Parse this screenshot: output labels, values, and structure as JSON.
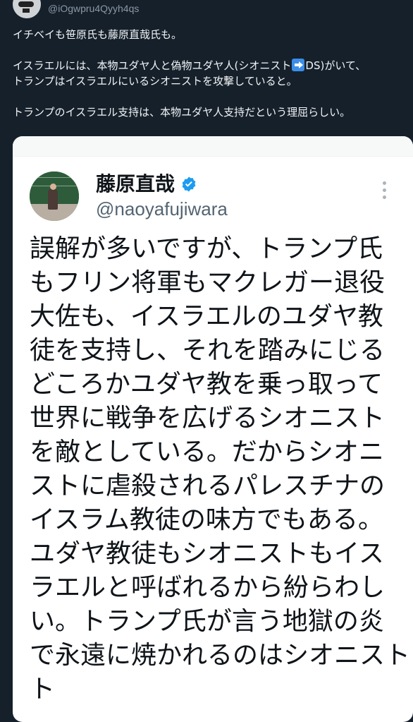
{
  "retweeter": {
    "handle": "@iOgwpru4Qyyh4qs"
  },
  "post": {
    "line1": "イチベイも笹原氏も藤原直哉氏も。",
    "line2a": "イスラエルには、本物ユダヤ人と偽物ユダヤ人(シオニスト",
    "line2b": "DS)がいて、",
    "line3": "トランプはイスラエルにいるシオニストを攻撃していると。",
    "line4": "トランプのイスラエル支持は、本物ユダヤ人支持だという理屈らしい。"
  },
  "quoted": {
    "name": "藤原直哉",
    "handle": "@naoyafujiwara",
    "body_lines": [
      "誤解が多いですが、トランプ氏",
      "もフリン将軍もマクレガー退役",
      "大佐も、イスラエルのユダヤ教",
      "徒を支持し、それを踏みにじる",
      "どころかユダヤ教を乗っ取って",
      "世界に戦争を広げるシオニスト",
      "を敵としている。だからシオニ",
      "ストに虐殺されるパレスチナの",
      "イスラム教徒の味方でもある。",
      "ユダヤ教徒もシオニストもイス",
      "ラエルと呼ばれるから紛らわし",
      "い。トランプ氏が言う地獄の炎",
      "で永遠に焼かれるのはシオニスト",
      "ト"
    ]
  },
  "colors": {
    "background": "#15202b",
    "accent": "#1d9bf0"
  },
  "icons": [
    "avatar",
    "right-arrow-icon",
    "verified-badge-icon",
    "more-options-icon"
  ]
}
